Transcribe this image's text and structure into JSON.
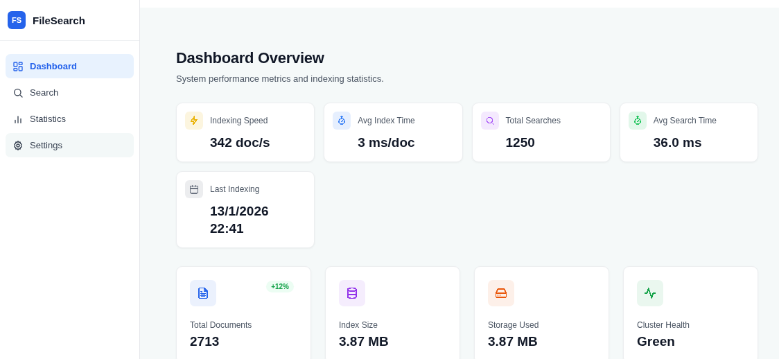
{
  "brand": {
    "logo": "FS",
    "name": "FileSearch"
  },
  "nav": [
    {
      "kind": "grid",
      "label": "Dashboard",
      "selected": true,
      "highlighted": false
    },
    {
      "kind": "search",
      "label": "Search",
      "selected": false,
      "highlighted": false
    },
    {
      "kind": "bars",
      "label": "Statistics",
      "selected": false,
      "highlighted": false
    },
    {
      "kind": "gear",
      "label": "Settings",
      "selected": false,
      "highlighted": true
    }
  ],
  "header": {
    "title": "Dashboard Overview",
    "subtitle": "System performance metrics and indexing statistics."
  },
  "metrics": [
    {
      "kind": "bolt",
      "color": "#eab308",
      "label": "Indexing Speed",
      "value": "342 doc/s"
    },
    {
      "kind": "timer",
      "color": "#3b82f6",
      "label": "Avg Index Time",
      "value": "3 ms/doc"
    },
    {
      "kind": "search",
      "color": "#a855f7",
      "label": "Total Searches",
      "value": "1250"
    },
    {
      "kind": "timer",
      "color": "#22c55e",
      "label": "Avg Search Time",
      "value": "36.0 ms"
    },
    {
      "kind": "calendar",
      "color": "#6b7280",
      "label": "Last Indexing",
      "value": "13/1/2026 22:41"
    }
  ],
  "summary": [
    {
      "kind": "document",
      "color": "#2563eb",
      "label": "Total Documents",
      "value": "2713",
      "badge": "+12%"
    },
    {
      "kind": "database",
      "color": "#9333ea",
      "label": "Index Size",
      "value": "3.87 MB"
    },
    {
      "kind": "drive",
      "color": "#ea580c",
      "label": "Storage Used",
      "value": "3.87 MB"
    },
    {
      "kind": "pulse",
      "color": "#16a34a",
      "label": "Cluster Health",
      "value": "Green"
    }
  ]
}
